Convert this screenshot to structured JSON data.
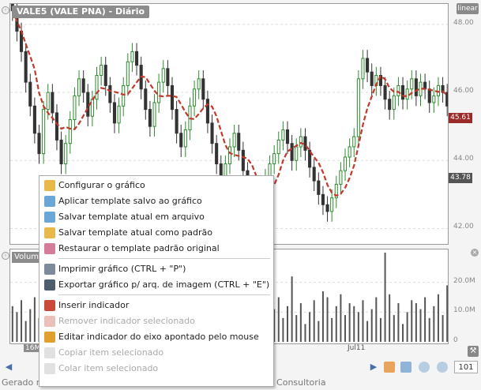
{
  "price_title": "VALE5 (VALE        PNA) - Diário",
  "scale_button": "linear",
  "price_ticks": [
    {
      "label": "48.00",
      "value": 48.0
    },
    {
      "label": "46.00",
      "value": 46.0
    },
    {
      "label": "44.00",
      "value": 44.0
    },
    {
      "label": "42.00",
      "value": 42.0
    }
  ],
  "last_price_tag": "45.61",
  "ma_tag": "43.78",
  "volume_title": "Volume",
  "volume_ticks": [
    {
      "label": "20.0M",
      "value": 20
    },
    {
      "label": "10.0M",
      "value": 10
    },
    {
      "label": "0",
      "value": 0
    }
  ],
  "x_labels": {
    "first": "16M",
    "second": "Jul11"
  },
  "zoom_value": "101",
  "footer": "Gerado na ferramenta GrapherOC - Copyright 2008, OperAção Consultoria",
  "context_menu": [
    {
      "label": "Configurar o gráfico",
      "enabled": true,
      "icon": "settings-icon",
      "color": "#e8b84a"
    },
    {
      "label": "Aplicar template salvo ao gráfico",
      "enabled": true,
      "icon": "apply-template-icon",
      "color": "#6aa6d6"
    },
    {
      "label": "Salvar template atual em arquivo",
      "enabled": true,
      "icon": "save-template-icon",
      "color": "#6aa6d6"
    },
    {
      "label": "Salvar template atual como padrão",
      "enabled": true,
      "icon": "save-default-icon",
      "color": "#e8b84a"
    },
    {
      "label": "Restaurar o template padrão original",
      "enabled": true,
      "icon": "restore-icon",
      "color": "#d47d9a",
      "sep_after": true
    },
    {
      "label": "Imprimir gráfico  (CTRL + \"P\")",
      "enabled": true,
      "icon": "print-icon",
      "color": "#7c8a99"
    },
    {
      "label": "Exportar gráfico p/ arq. de imagem  (CTRL + \"E\")",
      "enabled": true,
      "icon": "camera-icon",
      "color": "#4d5d6e",
      "sep_after": true
    },
    {
      "label": "Inserir indicador",
      "enabled": true,
      "icon": "insert-indicator-icon",
      "color": "#c94a3a"
    },
    {
      "label": "Remover indicador selecionado",
      "enabled": false,
      "icon": "remove-indicator-icon",
      "color": "#c94a3a"
    },
    {
      "label": "Editar indicador do eixo apontado pelo mouse",
      "enabled": true,
      "icon": "edit-indicator-icon",
      "color": "#e0a030"
    },
    {
      "label": "Copiar item selecionado",
      "enabled": false,
      "icon": "copy-icon",
      "color": "#aaaaaa"
    },
    {
      "label": "Colar item selecionado",
      "enabled": false,
      "icon": "paste-icon",
      "color": "#aaaaaa"
    }
  ],
  "colors": {
    "up": "#2e8b2e",
    "down": "#333333",
    "ma": "#c0392b",
    "volume": "#555555"
  },
  "chart_data": {
    "type": "candlestick",
    "ylim": [
      41.5,
      48.6
    ],
    "closes": [
      48.4,
      47.8,
      47.2,
      46.3,
      45.6,
      44.8,
      44.2,
      45.5,
      46.0,
      45.4,
      44.6,
      43.9,
      44.5,
      45.2,
      45.9,
      46.4,
      46.0,
      45.3,
      45.8,
      46.5,
      46.8,
      46.2,
      45.7,
      45.1,
      45.6,
      46.2,
      46.9,
      47.2,
      46.8,
      46.1,
      45.5,
      45.0,
      45.7,
      46.3,
      46.7,
      46.2,
      45.5,
      44.8,
      44.4,
      44.9,
      45.6,
      46.1,
      46.4,
      45.8,
      45.1,
      44.5,
      43.9,
      43.5,
      43.9,
      44.4,
      44.8,
      44.3,
      43.7,
      43.2,
      42.8,
      42.4,
      42.9,
      43.5,
      43.9,
      44.2,
      44.6,
      44.9,
      44.5,
      44.0,
      44.4,
      44.7,
      44.3,
      43.8,
      43.4,
      43.0,
      42.7,
      42.5,
      42.9,
      43.3,
      43.7,
      44.1,
      44.4,
      44.7,
      46.4,
      47.0,
      46.6,
      46.2,
      46.5,
      46.2,
      45.8,
      45.5,
      45.9,
      46.2,
      45.8,
      46.1,
      46.4,
      45.9,
      46.3,
      46.1,
      45.7,
      45.9,
      46.2,
      46.0,
      45.6
    ]
  }
}
